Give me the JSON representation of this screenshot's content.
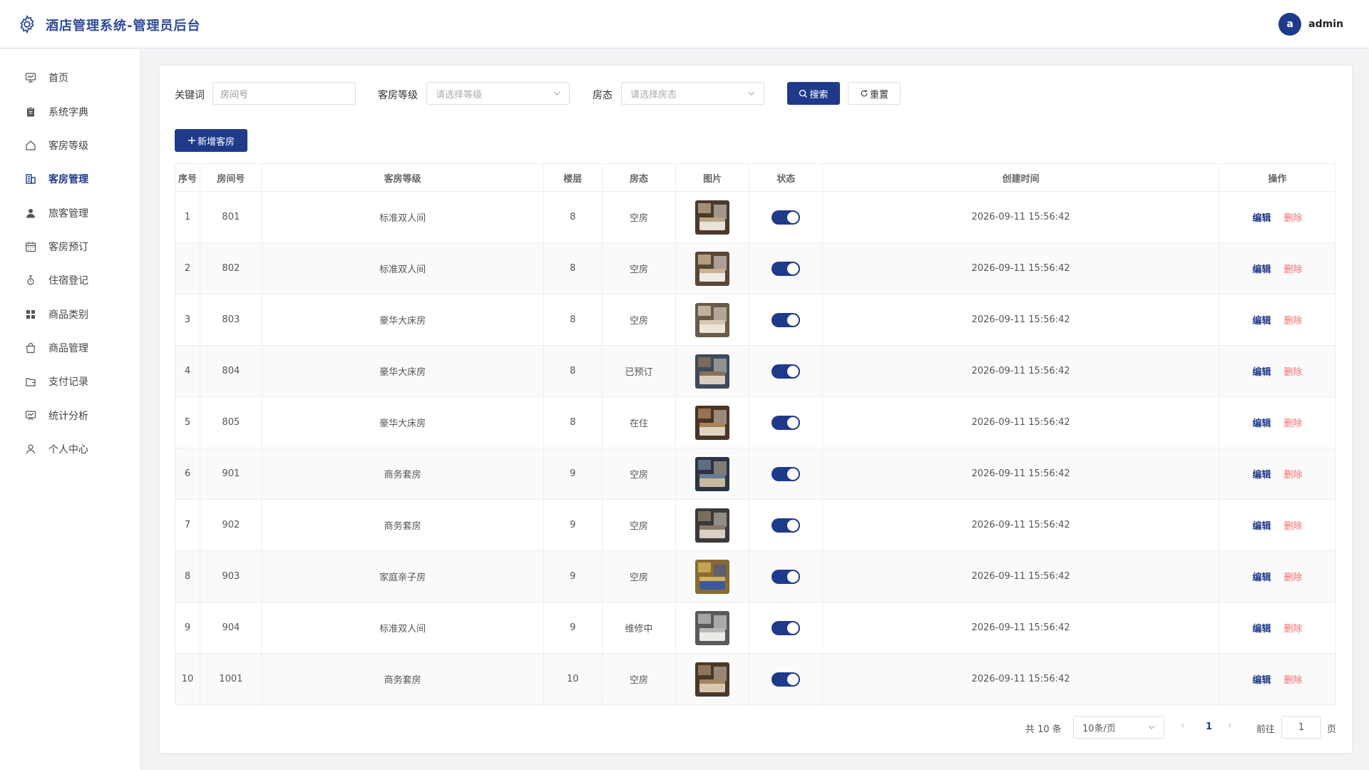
{
  "app": {
    "title": "酒店管理系统-管理员后台"
  },
  "user": {
    "avatar_letter": "a",
    "name": "admin"
  },
  "sidebar": {
    "items": [
      {
        "label": "首页",
        "icon": "monitor-icon"
      },
      {
        "label": "系统字典",
        "icon": "clipboard-icon"
      },
      {
        "label": "客房等级",
        "icon": "house-icon"
      },
      {
        "label": "客房管理",
        "icon": "building-icon",
        "active": true
      },
      {
        "label": "旅客管理",
        "icon": "user-filled-icon"
      },
      {
        "label": "客房预订",
        "icon": "calendar-icon"
      },
      {
        "label": "住宿登记",
        "icon": "stopwatch-icon"
      },
      {
        "label": "商品类别",
        "icon": "grid-icon"
      },
      {
        "label": "商品管理",
        "icon": "shopping-bag-icon"
      },
      {
        "label": "支付记录",
        "icon": "wallet-icon"
      },
      {
        "label": "统计分析",
        "icon": "chart-board-icon"
      },
      {
        "label": "个人中心",
        "icon": "user-outline-icon"
      }
    ]
  },
  "filters": {
    "keyword_label": "关键词",
    "keyword_placeholder": "房间号",
    "level_label": "客房等级",
    "level_placeholder": "请选择等级",
    "status_label": "房态",
    "status_placeholder": "请选择房态",
    "search_label": "搜索",
    "reset_label": "重置"
  },
  "toolbar": {
    "add_label": "新增客房"
  },
  "table": {
    "headers": [
      "序号",
      "房间号",
      "客房等级",
      "楼层",
      "房态",
      "图片",
      "状态",
      "创建时间",
      "操作"
    ],
    "edit_label": "编辑",
    "delete_label": "删除",
    "rows": [
      {
        "index": "1",
        "room": "801",
        "level": "标准双人间",
        "floor": "8",
        "status": "空房",
        "enabled": true,
        "created": "2026-09-11 15:56:42"
      },
      {
        "index": "2",
        "room": "802",
        "level": "标准双人间",
        "floor": "8",
        "status": "空房",
        "enabled": true,
        "created": "2026-09-11 15:56:42"
      },
      {
        "index": "3",
        "room": "803",
        "level": "豪华大床房",
        "floor": "8",
        "status": "空房",
        "enabled": true,
        "created": "2026-09-11 15:56:42"
      },
      {
        "index": "4",
        "room": "804",
        "level": "豪华大床房",
        "floor": "8",
        "status": "已预订",
        "enabled": true,
        "created": "2026-09-11 15:56:42"
      },
      {
        "index": "5",
        "room": "805",
        "level": "豪华大床房",
        "floor": "8",
        "status": "在住",
        "enabled": true,
        "created": "2026-09-11 15:56:42"
      },
      {
        "index": "6",
        "room": "901",
        "level": "商务套房",
        "floor": "9",
        "status": "空房",
        "enabled": true,
        "created": "2026-09-11 15:56:42"
      },
      {
        "index": "7",
        "room": "902",
        "level": "商务套房",
        "floor": "9",
        "status": "空房",
        "enabled": true,
        "created": "2026-09-11 15:56:42"
      },
      {
        "index": "8",
        "room": "903",
        "level": "家庭亲子房",
        "floor": "9",
        "status": "空房",
        "enabled": true,
        "created": "2026-09-11 15:56:42"
      },
      {
        "index": "9",
        "room": "904",
        "level": "标准双人间",
        "floor": "9",
        "status": "维修中",
        "enabled": true,
        "created": "2026-09-11 15:56:42"
      },
      {
        "index": "10",
        "room": "1001",
        "level": "商务套房",
        "floor": "10",
        "status": "空房",
        "enabled": true,
        "created": "2026-09-11 15:56:42"
      }
    ]
  },
  "pagination": {
    "total_text": "共 10 条",
    "page_size": "10条/页",
    "current_page": "1",
    "goto_label": "前往",
    "goto_value": "1",
    "page_suffix": "页"
  },
  "colors": {
    "primary": "#1f3a8a",
    "danger": "#f56c6c",
    "title": "#2f4a9a"
  }
}
